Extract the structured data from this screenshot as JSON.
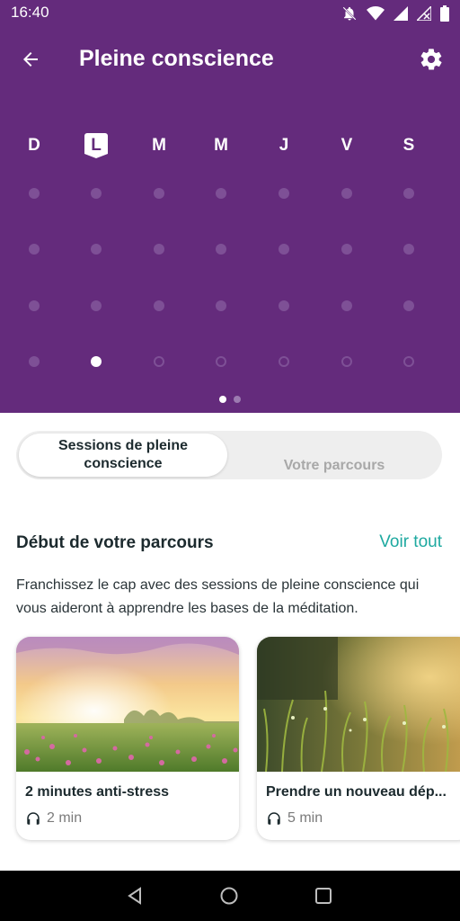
{
  "status": {
    "time": "16:40"
  },
  "header": {
    "title": "Pleine conscience"
  },
  "calendar": {
    "days": [
      "D",
      "L",
      "M",
      "M",
      "J",
      "V",
      "S"
    ],
    "selected_day_index": 1,
    "completed_cell": {
      "row": 3,
      "col": 1
    }
  },
  "segments": {
    "sessions_label": "Sessions de pleine conscience",
    "journey_label": "Votre parcours"
  },
  "section": {
    "title": "Début de votre parcours",
    "see_all": "Voir tout",
    "description": "Franchissez le cap avec des sessions de pleine conscience qui vous aideront à apprendre les bases de la méditation."
  },
  "cards": [
    {
      "title": "2 minutes anti-stress",
      "duration": "2 min",
      "icon": "headphones-icon"
    },
    {
      "title": "Prendre un nouveau dép...",
      "duration": "5 min",
      "icon": "headphones-icon"
    }
  ],
  "colors": {
    "primary": "#642b7c",
    "accent": "#1ea9a0"
  }
}
